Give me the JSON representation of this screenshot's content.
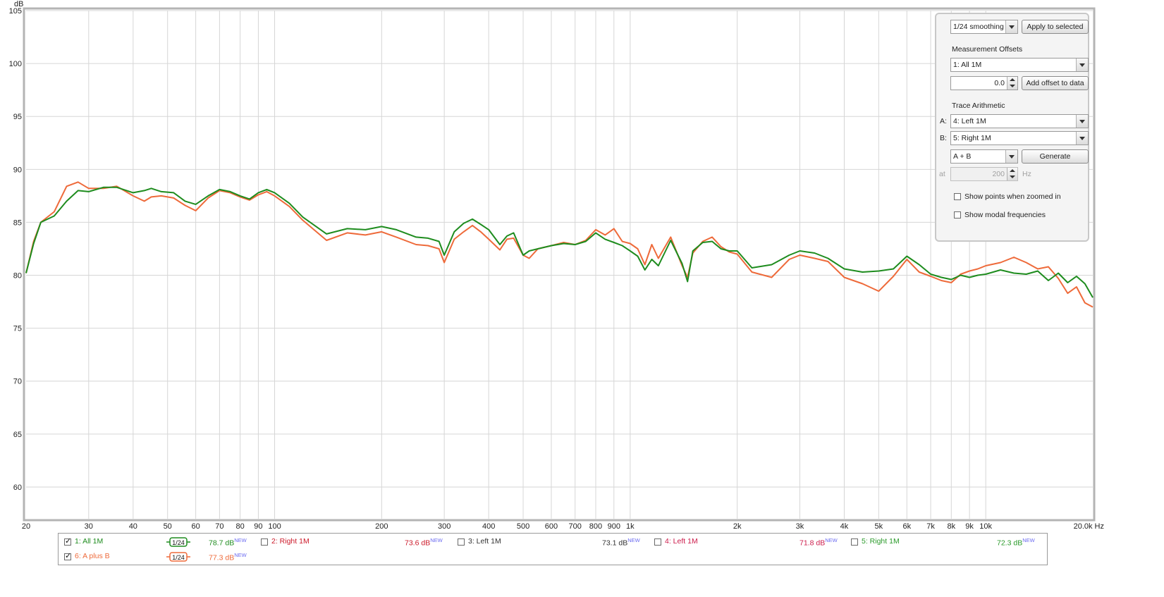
{
  "chart_data": {
    "type": "line",
    "ylabel": "dB",
    "xunit": "Hz",
    "xscale": "log",
    "xlim": [
      20,
      20000
    ],
    "ylim": [
      57,
      105
    ],
    "grid": true,
    "y_ticks": [
      60,
      65,
      70,
      75,
      80,
      85,
      90,
      95,
      100,
      105
    ],
    "x_ticks": [
      {
        "v": 20,
        "label": "20"
      },
      {
        "v": 30,
        "label": "30"
      },
      {
        "v": 40,
        "label": "40"
      },
      {
        "v": 50,
        "label": "50"
      },
      {
        "v": 60,
        "label": "60"
      },
      {
        "v": 70,
        "label": "70"
      },
      {
        "v": 80,
        "label": "80"
      },
      {
        "v": 90,
        "label": "90"
      },
      {
        "v": 100,
        "label": "100"
      },
      {
        "v": 200,
        "label": "200"
      },
      {
        "v": 300,
        "label": "300"
      },
      {
        "v": 400,
        "label": "400"
      },
      {
        "v": 500,
        "label": "500"
      },
      {
        "v": 600,
        "label": "600"
      },
      {
        "v": 700,
        "label": "700"
      },
      {
        "v": 800,
        "label": "800"
      },
      {
        "v": 900,
        "label": "900"
      },
      {
        "v": 1000,
        "label": "1k"
      },
      {
        "v": 2000,
        "label": "2k"
      },
      {
        "v": 3000,
        "label": "3k"
      },
      {
        "v": 4000,
        "label": "4k"
      },
      {
        "v": 5000,
        "label": "5k"
      },
      {
        "v": 6000,
        "label": "6k"
      },
      {
        "v": 7000,
        "label": "7k"
      },
      {
        "v": 8000,
        "label": "8k"
      },
      {
        "v": 9000,
        "label": "9k"
      },
      {
        "v": 10000,
        "label": "10k"
      },
      {
        "v": 20000,
        "label": "20.0k Hz"
      }
    ],
    "series": [
      {
        "name": "1: All 1M",
        "color": "#1e8c1e",
        "x": [
          20,
          21,
          22,
          24,
          26,
          28,
          30,
          33,
          36,
          40,
          43,
          45,
          48,
          52,
          56,
          60,
          65,
          70,
          75,
          80,
          85,
          90,
          95,
          100,
          110,
          120,
          140,
          160,
          180,
          200,
          220,
          250,
          270,
          290,
          300,
          320,
          340,
          360,
          380,
          400,
          430,
          450,
          470,
          500,
          520,
          550,
          600,
          650,
          700,
          750,
          800,
          850,
          900,
          950,
          1000,
          1050,
          1100,
          1150,
          1200,
          1300,
          1400,
          1450,
          1500,
          1600,
          1700,
          1800,
          1900,
          2000,
          2200,
          2500,
          2800,
          3000,
          3300,
          3600,
          4000,
          4500,
          5000,
          5500,
          6000,
          6500,
          7000,
          7500,
          8000,
          8500,
          9000,
          9500,
          10000,
          11000,
          12000,
          13000,
          14000,
          15000,
          16000,
          17000,
          18000,
          19000,
          20000
        ],
        "y": [
          80.2,
          83,
          85,
          85.6,
          87,
          88,
          87.9,
          88.3,
          88.3,
          87.8,
          88,
          88.2,
          87.9,
          87.8,
          87,
          86.7,
          87.5,
          88.1,
          87.9,
          87.5,
          87.2,
          87.8,
          88.1,
          87.8,
          86.8,
          85.5,
          83.9,
          84.4,
          84.3,
          84.6,
          84.3,
          83.6,
          83.5,
          83.2,
          81.9,
          84.1,
          84.9,
          85.3,
          84.8,
          84.3,
          82.9,
          83.7,
          84,
          81.9,
          82.3,
          82.5,
          82.8,
          83,
          82.9,
          83.2,
          84,
          83.4,
          83.1,
          82.8,
          82.3,
          81.8,
          80.5,
          81.5,
          80.9,
          83.3,
          81.1,
          79.4,
          82.3,
          83.1,
          83.2,
          82.5,
          82.3,
          82.3,
          80.7,
          81,
          81.9,
          82.3,
          82.1,
          81.6,
          80.6,
          80.3,
          80.4,
          80.6,
          81.8,
          81,
          80.1,
          79.8,
          79.6,
          80,
          79.8,
          80,
          80.1,
          80.5,
          80.2,
          80.1,
          80.4,
          79.5,
          80.2,
          79.3,
          79.9,
          79.2,
          77.9
        ]
      },
      {
        "name": "6: A plus B",
        "color": "#ee6a3a",
        "x": [
          20,
          21,
          22,
          24,
          26,
          28,
          30,
          33,
          36,
          40,
          43,
          45,
          48,
          52,
          56,
          60,
          65,
          70,
          75,
          80,
          85,
          90,
          95,
          100,
          110,
          120,
          140,
          160,
          180,
          200,
          220,
          250,
          270,
          290,
          300,
          320,
          340,
          360,
          380,
          400,
          430,
          450,
          470,
          500,
          520,
          550,
          600,
          650,
          700,
          750,
          800,
          850,
          900,
          950,
          1000,
          1050,
          1100,
          1150,
          1200,
          1300,
          1400,
          1450,
          1500,
          1600,
          1700,
          1800,
          1900,
          2000,
          2200,
          2500,
          2800,
          3000,
          3300,
          3600,
          4000,
          4500,
          5000,
          5500,
          6000,
          6500,
          7000,
          7500,
          8000,
          8500,
          9000,
          9500,
          10000,
          11000,
          12000,
          13000,
          14000,
          15000,
          16000,
          17000,
          18000,
          19000,
          20000
        ],
        "y": [
          80.2,
          83.2,
          85,
          86,
          88.4,
          88.8,
          88.2,
          88.2,
          88.4,
          87.5,
          87,
          87.4,
          87.5,
          87.3,
          86.6,
          86.1,
          87.3,
          88,
          87.8,
          87.4,
          87.1,
          87.6,
          87.9,
          87.5,
          86.5,
          85.2,
          83.3,
          84,
          83.8,
          84.1,
          83.6,
          82.9,
          82.8,
          82.5,
          81.2,
          83.4,
          84.1,
          84.7,
          84.1,
          83.4,
          82.4,
          83.4,
          83.5,
          81.9,
          81.6,
          82.5,
          82.8,
          83.1,
          82.9,
          83.3,
          84.3,
          83.8,
          84.4,
          83.2,
          83,
          82.5,
          81,
          82.9,
          81.6,
          83.6,
          80.9,
          79.8,
          82.1,
          83.2,
          83.6,
          82.7,
          82.2,
          82,
          80.3,
          79.8,
          81.5,
          81.9,
          81.6,
          81.3,
          79.8,
          79.2,
          78.5,
          79.9,
          81.5,
          80.3,
          79.9,
          79.5,
          79.3,
          80.1,
          80.4,
          80.6,
          80.9,
          81.2,
          81.7,
          81.2,
          80.6,
          80.8,
          79.7,
          78.3,
          78.9,
          77.4,
          77
        ]
      }
    ]
  },
  "panel": {
    "smoothing_value": "1/24 smoothing",
    "apply_label": "Apply to selected",
    "offsets_heading": "Measurement Offsets",
    "offset_measurement": "1: All 1M",
    "offset_value": "0.0",
    "add_offset_label": "Add offset to data",
    "arith_heading": "Trace Arithmetic",
    "a_label": "A:",
    "a_value": "4: Left 1M",
    "b_label": "B:",
    "b_value": "5: Right 1M",
    "op_value": "A + B",
    "generate_label": "Generate",
    "at_label": "at",
    "at_value": "200",
    "hz_label": "Hz",
    "show_points_label": "Show points when zoomed in",
    "show_modal_label": "Show modal frequencies"
  },
  "legend": {
    "items": [
      {
        "name": "1: All 1M",
        "value": "78.7 dB",
        "badge": "NEW",
        "checked": true,
        "color": "#1e8c1e",
        "smoothing": "1/24"
      },
      {
        "name": "2: Right 1M",
        "value": "73.6 dB",
        "badge": "NEW",
        "checked": false,
        "color": "#cc1a2a"
      },
      {
        "name": "3: Left 1M",
        "value": "73.1 dB",
        "badge": "NEW",
        "checked": false,
        "color": "#333333"
      },
      {
        "name": "4: Left 1M",
        "value": "71.8 dB",
        "badge": "NEW",
        "checked": false,
        "color": "#cc1a4a"
      },
      {
        "name": "5: Right 1M",
        "value": "72.3 dB",
        "badge": "NEW",
        "checked": false,
        "color": "#2a9a2a"
      },
      {
        "name": "6: A plus B",
        "value": "77.3 dB",
        "badge": "NEW",
        "checked": true,
        "color": "#ee6a3a",
        "smoothing": "1/24"
      }
    ]
  }
}
